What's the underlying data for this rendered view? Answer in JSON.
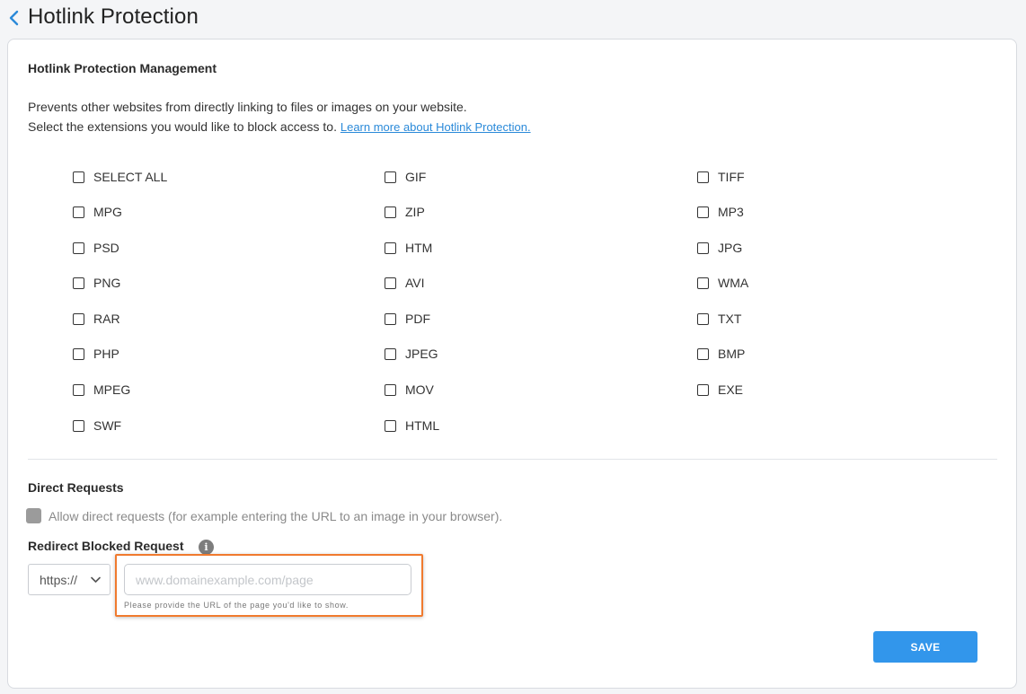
{
  "header": {
    "title": "Hotlink Protection"
  },
  "management": {
    "title": "Hotlink Protection Management",
    "desc_line1": "Prevents other websites from directly linking to files or images on your website.",
    "desc_line2": "Select the extensions you would like to block access to.",
    "learn_more": "Learn more about Hotlink Protection."
  },
  "extensions": {
    "col1": [
      "SELECT ALL",
      "MPG",
      "PSD",
      "PNG",
      "RAR",
      "PHP",
      "MPEG",
      "SWF"
    ],
    "col2": [
      "GIF",
      "ZIP",
      "HTM",
      "AVI",
      "PDF",
      "JPEG",
      "MOV",
      "HTML"
    ],
    "col3": [
      "TIFF",
      "MP3",
      "JPG",
      "WMA",
      "TXT",
      "BMP",
      "EXE"
    ]
  },
  "direct": {
    "title": "Direct Requests",
    "allow_label": "Allow direct requests (for example entering the URL to an image in your browser)."
  },
  "redirect": {
    "title": "Redirect Blocked Request",
    "protocol": "https://",
    "placeholder": "www.domainexample.com/page",
    "hint": "Please provide the URL of the page you'd like to show."
  },
  "save_label": "SAVE",
  "colors": {
    "accent": "#3296eb",
    "highlight": "#f07a2e",
    "link": "#2b8ad9"
  }
}
